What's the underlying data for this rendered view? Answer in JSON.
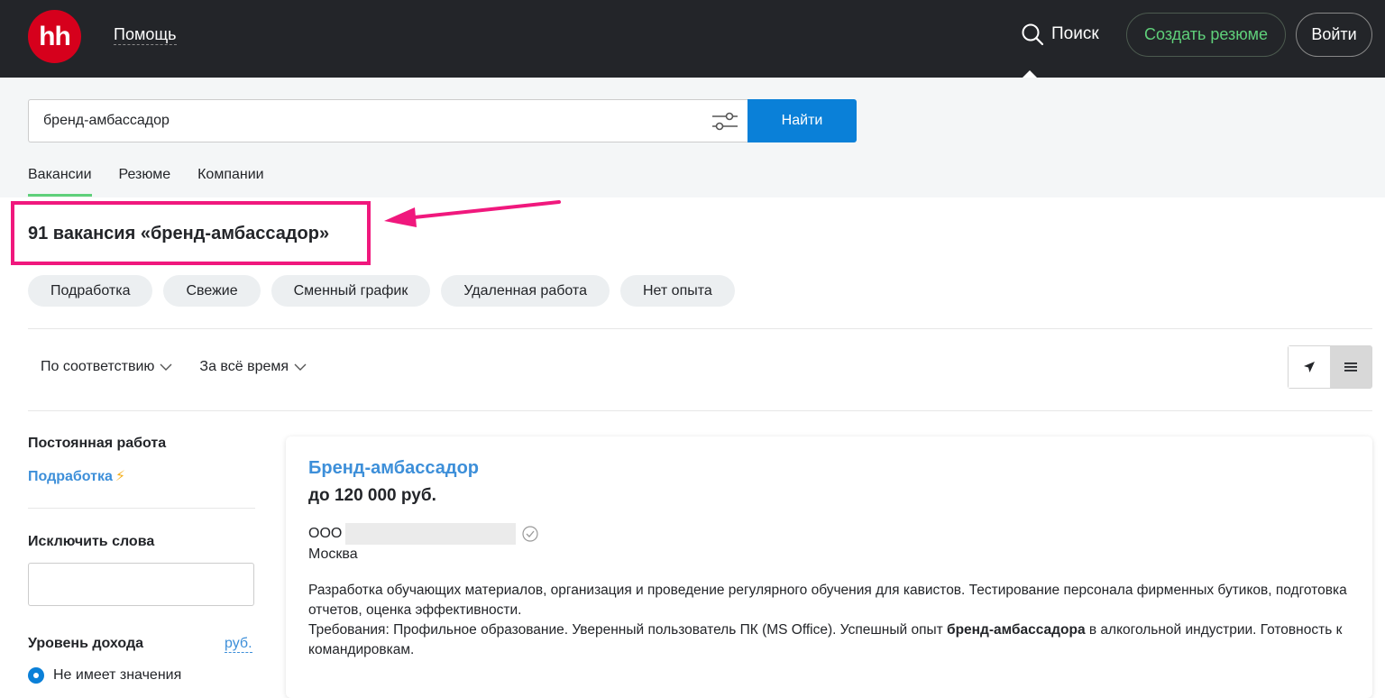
{
  "header": {
    "logo_text": "hh",
    "help_label": "Помощь",
    "search_label": "Поиск",
    "create_resume_label": "Создать резюме",
    "login_label": "Войти"
  },
  "search": {
    "query": "бренд-амбассадор",
    "find_label": "Найти"
  },
  "tabs": [
    {
      "label": "Вакансии",
      "active": true
    },
    {
      "label": "Резюме",
      "active": false
    },
    {
      "label": "Компании",
      "active": false
    }
  ],
  "results": {
    "title": "91 вакансия «бренд-амбассадор»"
  },
  "chips": [
    "Подработка",
    "Свежие",
    "Сменный график",
    "Удаленная работа",
    "Нет опыта"
  ],
  "sort": {
    "relevance_label": "По соответствию",
    "period_label": "За всё время"
  },
  "filters": {
    "employment_title": "Постоянная работа",
    "part_time_link": "Подработка",
    "exclude_title": "Исключить слова",
    "income_title": "Уровень дохода",
    "currency_label": "руб.",
    "income_option": "Не имеет значения"
  },
  "vacancy": {
    "title": "Бренд-амбассадор",
    "salary": "до 120 000 руб.",
    "company_prefix": "ООО",
    "city": "Москва",
    "description_line1": "Разработка обучающих материалов, организация и проведение регулярного обучения для кавистов. Тестирование персонала фирменных бутиков, подготовка отчетов, оценка эффективности.",
    "requirements_before": "Требования: Профильное образование. Уверенный пользователь ПК (MS Office). Успешный опыт ",
    "requirements_bold": "бренд-амбассадора",
    "requirements_after": " в алкогольной индустрии. Готовность к командировкам."
  },
  "colors": {
    "header_bg": "#232529",
    "logo_red": "#d6001c",
    "accent_green": "#5fd07a",
    "button_blue": "#0a80d8",
    "link_blue": "#3d8fd9",
    "highlight_pink": "#f0187d"
  }
}
